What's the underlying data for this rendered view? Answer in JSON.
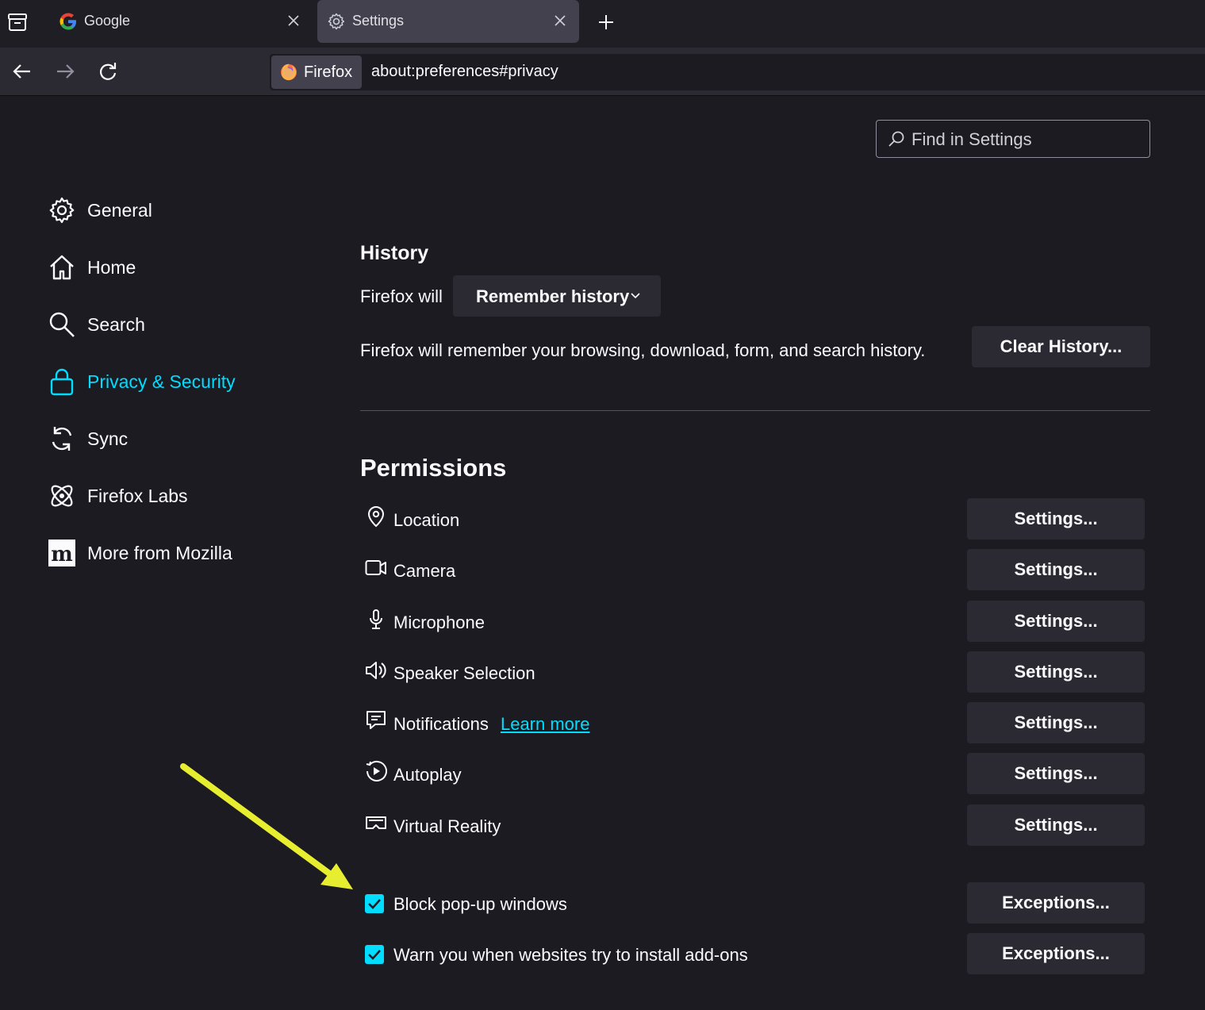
{
  "tabs": [
    {
      "title": "Google",
      "favicon": "google-icon"
    },
    {
      "title": "Settings",
      "favicon": "gear-icon",
      "active": true
    }
  ],
  "nav": {
    "identity_label": "Firefox",
    "url": "about:preferences#privacy"
  },
  "search": {
    "placeholder": "Find in Settings"
  },
  "sidebar": {
    "items": [
      {
        "label": "General",
        "icon": "gear-icon"
      },
      {
        "label": "Home",
        "icon": "home-icon"
      },
      {
        "label": "Search",
        "icon": "search-icon"
      },
      {
        "label": "Privacy & Security",
        "icon": "lock-icon",
        "selected": true
      },
      {
        "label": "Sync",
        "icon": "sync-icon"
      },
      {
        "label": "Firefox Labs",
        "icon": "labs-icon"
      },
      {
        "label": "More from Mozilla",
        "icon": "mozilla-icon"
      }
    ]
  },
  "history": {
    "heading": "History",
    "firefox_will": "Firefox will",
    "mode": "Remember history",
    "description": "Firefox will remember your browsing, download, form, and search history.",
    "clear_button": "Clear History..."
  },
  "permissions": {
    "heading": "Permissions",
    "items": [
      {
        "label": "Location",
        "icon": "location-icon",
        "button": "Settings..."
      },
      {
        "label": "Camera",
        "icon": "camera-icon",
        "button": "Settings..."
      },
      {
        "label": "Microphone",
        "icon": "microphone-icon",
        "button": "Settings..."
      },
      {
        "label": "Speaker Selection",
        "icon": "speaker-icon",
        "button": "Settings..."
      },
      {
        "label": "Notifications",
        "icon": "notification-icon",
        "button": "Settings...",
        "link": "Learn more"
      },
      {
        "label": "Autoplay",
        "icon": "autoplay-icon",
        "button": "Settings..."
      },
      {
        "label": "Virtual Reality",
        "icon": "vr-icon",
        "button": "Settings..."
      }
    ],
    "checkboxes": [
      {
        "label": "Block pop-up windows",
        "checked": true,
        "button": "Exceptions..."
      },
      {
        "label": "Warn you when websites try to install add-ons",
        "checked": true,
        "button": "Exceptions..."
      }
    ]
  },
  "colors": {
    "background": "#1c1b22",
    "accent": "#00ddff",
    "button": "#2b2a33",
    "annotation_arrow": "#e6ee2f"
  }
}
